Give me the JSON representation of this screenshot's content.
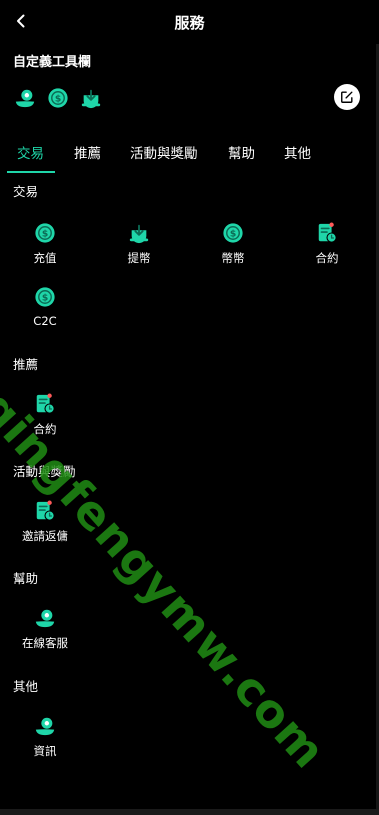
{
  "header": {
    "title": "服務"
  },
  "toolbar": {
    "label": "自定義工具欄",
    "icons": [
      "headset-icon",
      "coin-icon",
      "download-icon"
    ]
  },
  "tabs": [
    {
      "label": "交易"
    },
    {
      "label": "推薦"
    },
    {
      "label": "活動與獎勵"
    },
    {
      "label": "幫助"
    },
    {
      "label": "其他"
    }
  ],
  "sections": {
    "trade": {
      "title": "交易",
      "items": [
        {
          "label": "充值",
          "icon": "coin-icon"
        },
        {
          "label": "提幣",
          "icon": "download-icon"
        },
        {
          "label": "幣幣",
          "icon": "coin-icon"
        },
        {
          "label": "合約",
          "icon": "contract-icon"
        },
        {
          "label": "C2C",
          "icon": "coin-icon"
        }
      ]
    },
    "referral": {
      "title": "推薦",
      "items": [
        {
          "label": "合約",
          "icon": "contract-icon"
        }
      ]
    },
    "rewards": {
      "title": "活動與獎勵",
      "items": [
        {
          "label": "邀請返傭",
          "icon": "contract-icon"
        }
      ]
    },
    "help": {
      "title": "幫助",
      "items": [
        {
          "label": "在線客服",
          "icon": "headset-icon"
        }
      ]
    },
    "other": {
      "title": "其他",
      "items": [
        {
          "label": "資訊",
          "icon": "headset-icon"
        }
      ]
    }
  },
  "watermark": "qingfengymw.com",
  "colors": {
    "accent": "#1fd6a9",
    "background": "#000000",
    "watermark": "#208c14"
  }
}
